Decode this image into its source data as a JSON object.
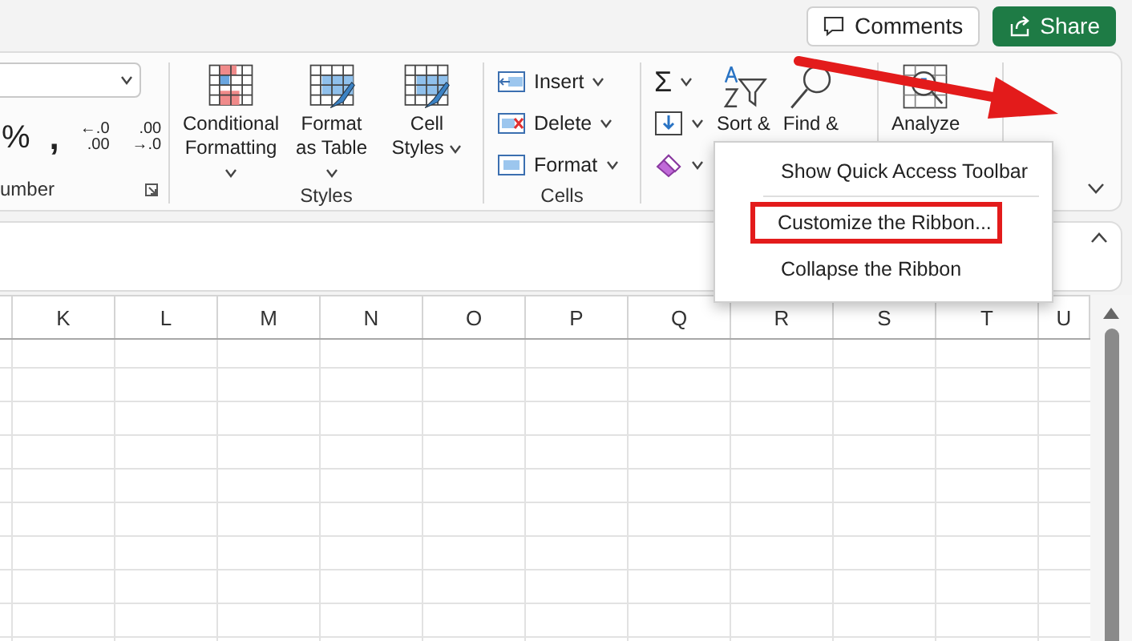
{
  "top_bar": {
    "buttons": [
      {
        "kind": "comments",
        "label": "Comments"
      },
      {
        "kind": "share",
        "label": "Share"
      }
    ]
  },
  "ribbon": {
    "groups": [
      {
        "kind": "number",
        "label": "umber",
        "commands": [
          {
            "kind": "symbol",
            "label": "%"
          },
          {
            "kind": "symbol",
            "label": ","
          },
          {
            "kind": "decimal-increase",
            "lines": [
              "←.0",
              ".00"
            ]
          },
          {
            "kind": "decimal-decrease",
            "lines": [
              ".00",
              "→.0"
            ]
          }
        ]
      },
      {
        "kind": "large",
        "label": "Styles",
        "commands": [
          {
            "kind": "conditional",
            "label": "Conditional Formatting"
          },
          {
            "kind": "table",
            "label": "Format as Table"
          },
          {
            "kind": "styles",
            "label": "Cell Styles"
          }
        ]
      },
      {
        "kind": "stack",
        "label": "Cells",
        "commands": [
          {
            "kind": "insert",
            "label": "Insert"
          },
          {
            "kind": "delete",
            "label": "Delete"
          },
          {
            "kind": "format",
            "label": "Format"
          }
        ]
      },
      {
        "kind": "editing",
        "commands": [
          {
            "kind": "sum",
            "label": "Σ"
          },
          {
            "kind": "fill"
          },
          {
            "kind": "clear"
          },
          {
            "kind": "sort",
            "label": "Sort &"
          },
          {
            "kind": "find",
            "label": "Find &"
          }
        ]
      },
      {
        "kind": "large",
        "commands": [
          {
            "kind": "analyze",
            "label": "Analyze"
          }
        ]
      }
    ]
  },
  "context_menu": {
    "items": [
      {
        "kind": "item",
        "label": "Show Quick Access Toolbar",
        "highlighted": false
      },
      {
        "kind": "separator"
      },
      {
        "kind": "item",
        "label": "Customize the Ribbon...",
        "highlighted": true
      },
      {
        "kind": "item",
        "label": "Collapse the Ribbon",
        "highlighted": false
      }
    ]
  },
  "sheet": {
    "columns": [
      "K",
      "L",
      "M",
      "N",
      "O",
      "P",
      "Q",
      "R",
      "S",
      "T",
      "U"
    ]
  }
}
